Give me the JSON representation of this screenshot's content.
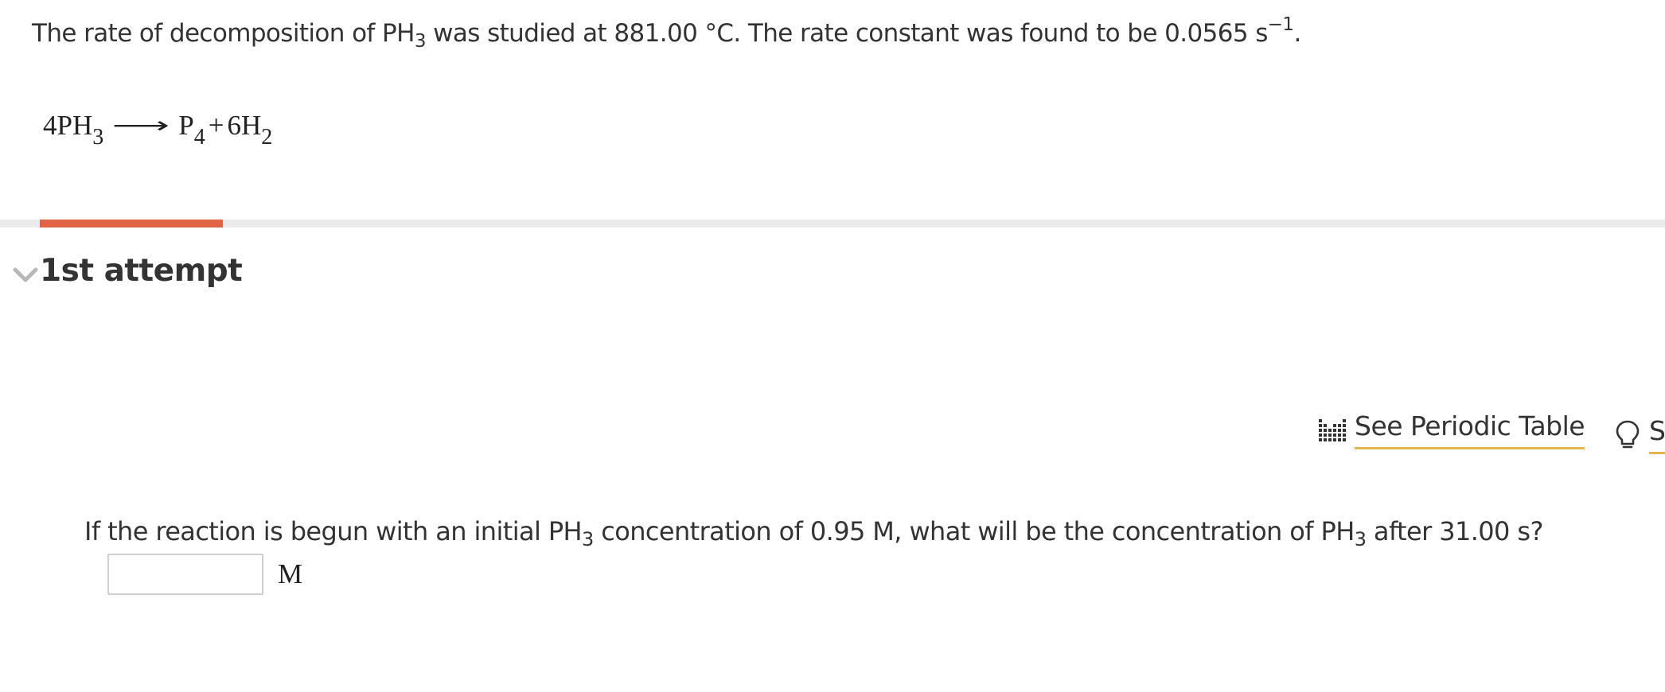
{
  "problem": {
    "intro_part1": "The rate of decomposition of PH",
    "intro_sub": "3",
    "intro_part2": " was studied at 881.00 °C. The rate constant was found to be 0.0565  s",
    "intro_sup": "−1",
    "intro_part3": "."
  },
  "equation": {
    "reactant": "4PH",
    "reactant_sub": "3",
    "arrow": "⟶",
    "product1": "P",
    "product1_sub": "4",
    "plus": "+",
    "product2": "6H",
    "product2_sub": "2"
  },
  "progress": {
    "fraction": 0.11,
    "fill_color": "#e26446",
    "track_color": "#ebebeb"
  },
  "attempt": {
    "title": "1st attempt",
    "icon": "chevron-down-icon"
  },
  "tools": {
    "periodic_table_label": "See Periodic Table",
    "periodic_icon": "periodic-grid-icon",
    "hint_label": "S",
    "hint_icon": "lightbulb-icon",
    "underline_color": "#e3b54f"
  },
  "question": {
    "part1": "If the reaction is begun with an initial PH",
    "sub1": "3",
    "part2": " concentration of 0.95 M, what will be the concentration of PH",
    "sub2": "3",
    "part3": " after 31.00  s?"
  },
  "answer": {
    "value": "",
    "placeholder": "",
    "unit": "M"
  }
}
